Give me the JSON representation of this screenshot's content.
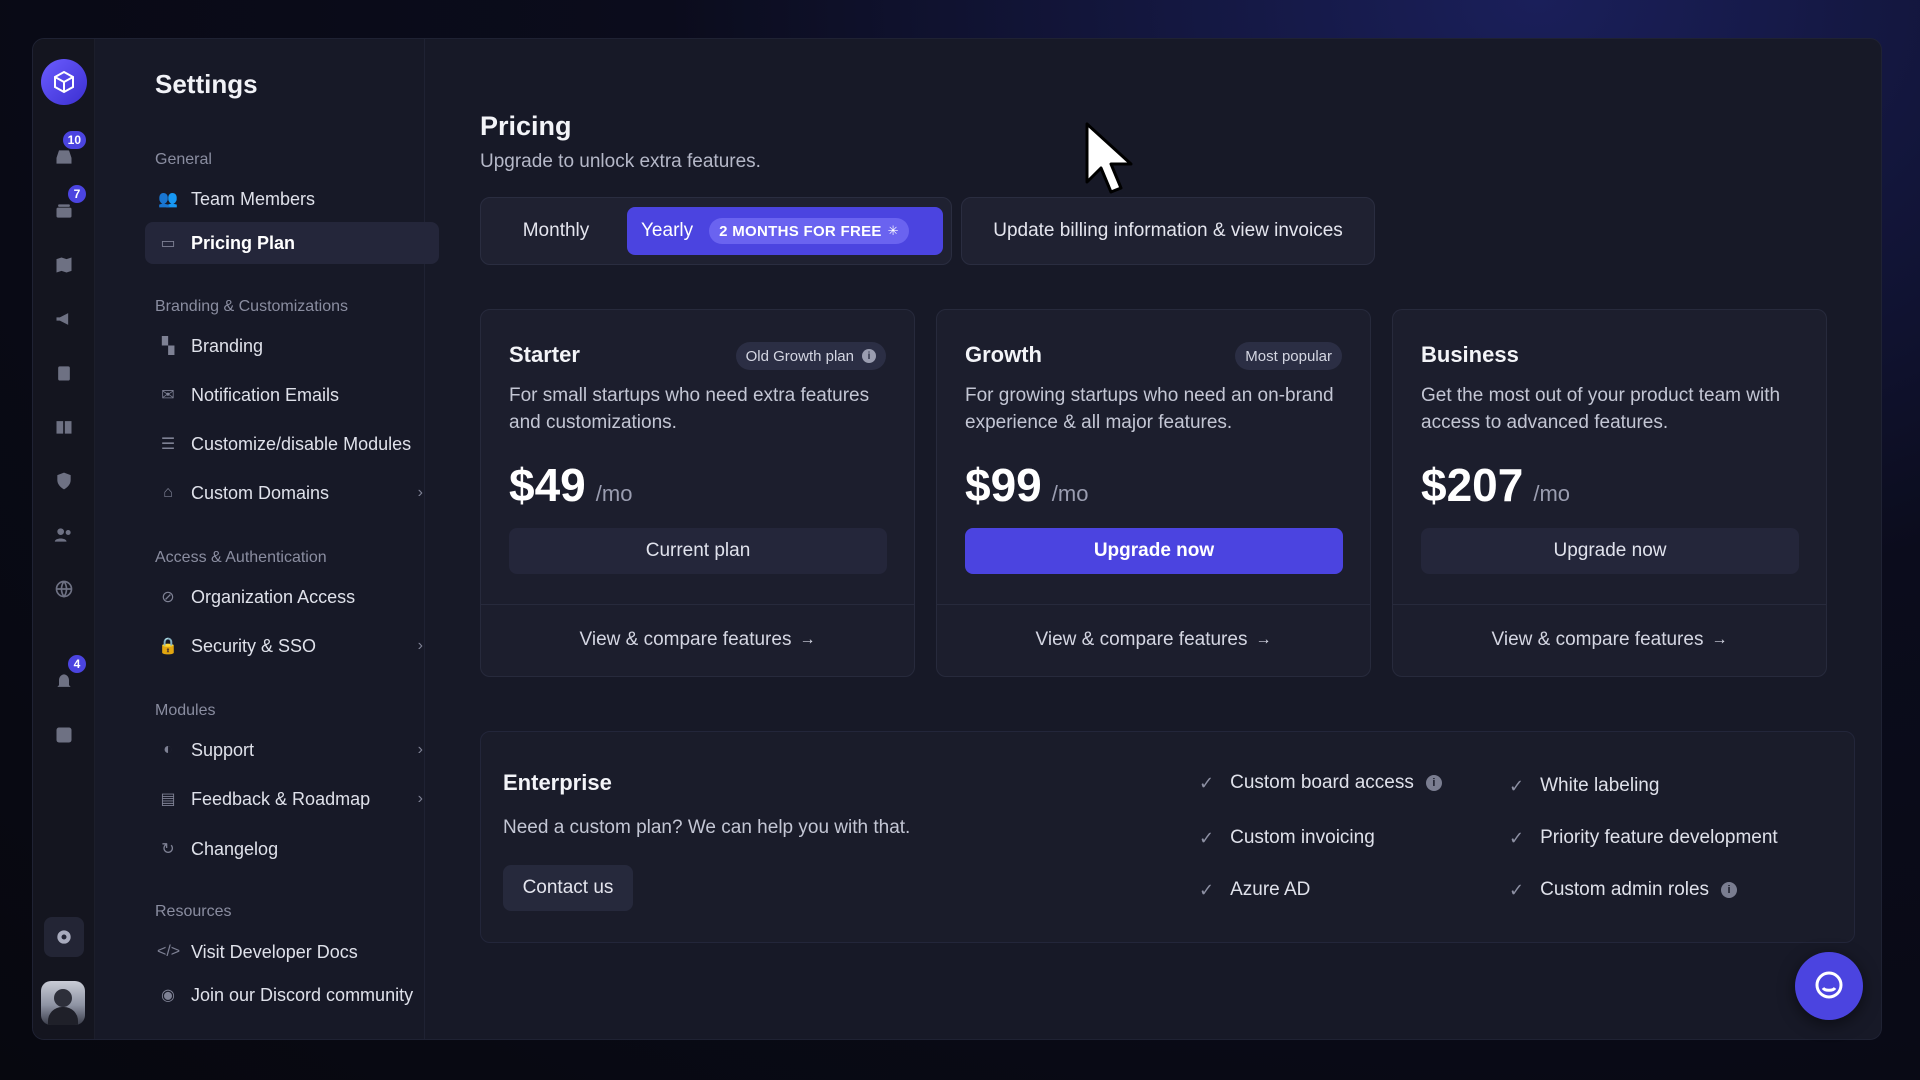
{
  "sidebar": {
    "title": "Settings",
    "sections": {
      "general": "General",
      "branding": "Branding & Customizations",
      "access": "Access & Authentication",
      "modules": "Modules",
      "resources": "Resources"
    },
    "items": {
      "team_members": "Team Members",
      "pricing_plan": "Pricing Plan",
      "branding": "Branding",
      "notification_emails": "Notification Emails",
      "customize_modules": "Customize/disable Modules",
      "custom_domains": "Custom Domains",
      "organization_access": "Organization Access",
      "security_sso": "Security & SSO",
      "support": "Support",
      "feedback_roadmap": "Feedback & Roadmap",
      "changelog": "Changelog",
      "developer_docs": "Visit Developer Docs",
      "discord": "Join our Discord community"
    }
  },
  "rail": {
    "badges": {
      "inbox": "10",
      "stack": "7",
      "notifications": "4"
    }
  },
  "pricing": {
    "title": "Pricing",
    "subtitle": "Upgrade to unlock extra features.",
    "toggle": {
      "monthly": "Monthly",
      "yearly": "Yearly",
      "promo": "2 MONTHS FOR FREE",
      "selected": "Yearly"
    },
    "billing_button": "Update billing information & view invoices",
    "plans": [
      {
        "name": "Starter",
        "tag": "Old Growth plan",
        "description": "For small startups who need extra features and customizations.",
        "price": "$49",
        "period": "/mo",
        "button": "Current plan",
        "link": "View & compare features"
      },
      {
        "name": "Growth",
        "tag": "Most popular",
        "description": "For growing startups who need an on-brand experience & all major features.",
        "price": "$99",
        "period": "/mo",
        "button": "Upgrade now",
        "link": "View & compare features"
      },
      {
        "name": "Business",
        "tag": "",
        "description": "Get the most out of your product team with access to advanced features.",
        "price": "$207",
        "period": "/mo",
        "button": "Upgrade now",
        "link": "View & compare features"
      }
    ],
    "enterprise": {
      "title": "Enterprise",
      "description": "Need a custom plan? We can help you with that.",
      "button": "Contact us",
      "features": [
        "Custom board access",
        "White labeling",
        "Custom invoicing",
        "Priority feature development",
        "Azure AD",
        "Custom admin roles"
      ]
    }
  },
  "colors": {
    "accent": "#4b44e0",
    "panel": "#171927",
    "card": "#1c1e2d"
  }
}
